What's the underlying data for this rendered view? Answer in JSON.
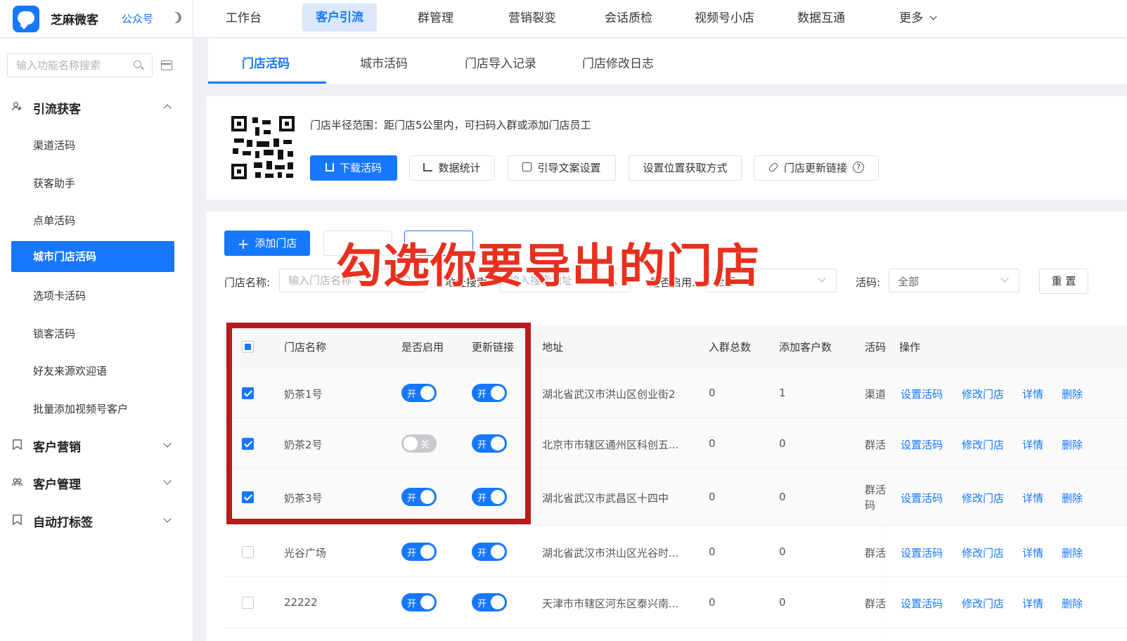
{
  "app": {
    "brand": "芝麻微客",
    "brand_sub": "公众号"
  },
  "nav": [
    "工作台",
    "客户引流",
    "群管理",
    "营销裂变",
    "会话质检",
    "视频号小店",
    "数据互通",
    "更多"
  ],
  "nav_active": "客户引流",
  "sidebar": {
    "search_placeholder": "输入功能名称搜索",
    "groups": [
      {
        "label": "引流获客",
        "icon": "user-add-icon",
        "expanded": true,
        "items": [
          "渠道活码",
          "获客助手",
          "点单活码",
          "城市门店活码",
          "选项卡活码",
          "锁客活码",
          "好友来源欢迎语",
          "批量添加视频号客户"
        ]
      },
      {
        "label": "客户营销",
        "icon": "bookmark-icon",
        "expanded": false
      },
      {
        "label": "客户管理",
        "icon": "team-icon",
        "expanded": false
      },
      {
        "label": "自动打标签",
        "icon": "bookmark-icon",
        "expanded": false
      }
    ],
    "active_item": "城市门店活码"
  },
  "subtabs": [
    "门店活码",
    "城市活码",
    "门店导入记录",
    "门店修改日志"
  ],
  "info": {
    "text": "门店半径范围：距门店5公里内，可扫码入群或添加门店员工",
    "buttons": {
      "download": "下载活码",
      "stats": "数据统计",
      "guide": "引导文案设置",
      "location": "设置位置获取方式",
      "update_link": "门店更新链接"
    }
  },
  "actions": {
    "add_store": "添加门店"
  },
  "filters": {
    "name_label": "门店名称:",
    "name_placeholder": "输入门店名称",
    "addr_label": "地址搜索:",
    "addr_placeholder": "输入搜索地址",
    "enabled_label": "是否启用:",
    "enabled_value": "全部",
    "code_label": "活码:",
    "code_value": "全部",
    "reset": "重 置"
  },
  "table": {
    "headers": {
      "name": "门店名称",
      "enabled": "是否启用",
      "update_link": "更新链接",
      "address": "地址",
      "group_total": "入群总数",
      "added": "添加客户数",
      "code": "活码",
      "ops": "操作"
    },
    "rows": [
      {
        "checked": true,
        "name": "奶茶1号",
        "enabled": true,
        "update_link": true,
        "address": "湖北省武汉市洪山区创业街2",
        "group_total": "0",
        "added": "1",
        "code": "渠道"
      },
      {
        "checked": true,
        "name": "奶茶2号",
        "enabled": false,
        "update_link": true,
        "address": "北京市市辖区通州区科创五...",
        "group_total": "0",
        "added": "0",
        "code": "群活"
      },
      {
        "checked": true,
        "name": "奶茶3号",
        "enabled": true,
        "update_link": true,
        "address": "湖北省武汉市武昌区十四中",
        "group_total": "0",
        "added": "0",
        "code": "群活\n码"
      },
      {
        "checked": false,
        "name": "光谷广场",
        "enabled": true,
        "update_link": true,
        "address": "湖北省武汉市洪山区光谷时...",
        "group_total": "0",
        "added": "0",
        "code": "群活"
      },
      {
        "checked": false,
        "name": "22222",
        "enabled": true,
        "update_link": true,
        "address": "天津市市辖区河东区泰兴南...",
        "group_total": "0",
        "added": "0",
        "code": "群活"
      }
    ],
    "switch_on": "开",
    "switch_off": "关",
    "ops": [
      "设置活码",
      "修改门店",
      "详情",
      "删除"
    ]
  },
  "annotation": "勾选你要导出的门店",
  "colors": {
    "primary": "#1677ff",
    "highlight": "#b71c1c",
    "annotation": "#e8301f"
  }
}
